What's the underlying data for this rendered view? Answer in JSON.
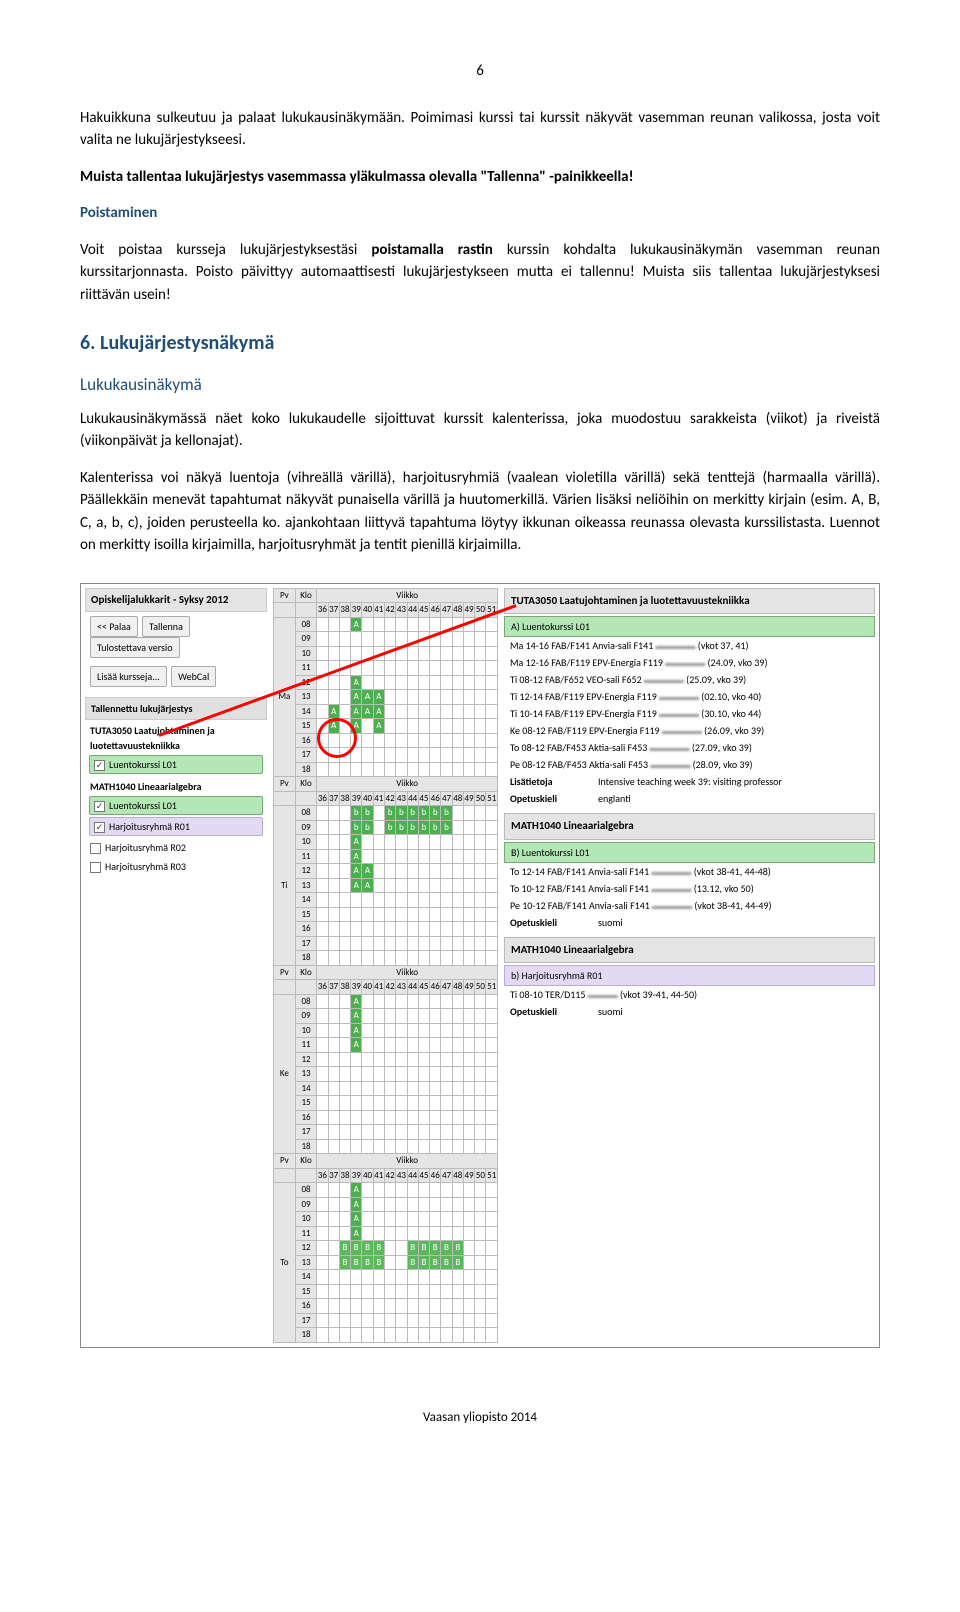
{
  "page_number": "6",
  "paragraphs": {
    "p1": "Hakuikkuna sulkeutuu ja palaat lukukausinäkymään. Poimimasi kurssi tai kurssit näkyvät vasemman reunan valikossa, josta voit valita ne lukujärjestykseesi.",
    "p2": "Muista tallentaa lukujärjestys vasemmassa yläkulmassa olevalla \"Tallenna\" -painikkeella!",
    "h_poistaminen": "Poistaminen",
    "p3a": "Voit poistaa kursseja lukujärjestyksestäsi ",
    "p3b": "poistamalla rastin",
    "p3c": " kurssin kohdalta lukukausinäkymän vasemman reunan kurssitarjonnasta. Poisto päivittyy automaattisesti lukujärjestykseen mutta ei tallennu! Muista siis tallentaa lukujärjestyksesi riittävän usein!",
    "h_section6": "6. Lukujärjestysnäkymä",
    "h_lukukausi": "Lukukausinäkymä",
    "p4": "Lukukausinäkymässä näet koko lukukaudelle sijoittuvat kurssit kalenterissa, joka muodostuu sarakkeista (viikot) ja riveistä (viikonpäivät ja kellonajat).",
    "p5": "Kalenterissa voi näkyä luentoja (vihreällä värillä), harjoitusryhmiä (vaalean violetilla värillä) sekä tenttejä (harmaalla värillä). Päällekkäin menevät tapahtumat näkyvät punaisella värillä ja huutomerkillä. Värien lisäksi neliöihin on merkitty kirjain (esim. A, B, C, a, b, c), joiden perusteella ko. ajankohtaan liittyvä tapahtuma löytyy ikkunan oikeassa reunassa olevasta kurssilistasta. Luennot on merkitty isoilla kirjaimilla, harjoitusryhmät ja tentit pienillä kirjaimilla."
  },
  "screenshot": {
    "panel_title": "Opiskelijalukkarit - Syksy 2012",
    "buttons": {
      "back": "<< Palaa",
      "save": "Tallenna",
      "print": "Tulostettava versio",
      "add": "Lisää kursseja...",
      "webcal": "WebCal"
    },
    "saved_title": "Tallennettu lukujärjestys",
    "course1": {
      "title": "TUTA3050 Laatujohtaminen ja luotettavuustekniikka",
      "item": "Luentokurssi L01"
    },
    "course2": {
      "title": "MATH1040 Lineaarialgebra",
      "items": [
        "Luentokurssi L01",
        "Harjoitusryhmä R01",
        "Harjoitusryhmä R02",
        "Harjoitusryhmä R03"
      ]
    },
    "cal": {
      "viikko": "Viikko",
      "pv": "Pv",
      "klo": "Klo",
      "weeks": [
        "36",
        "37",
        "38",
        "39",
        "40",
        "41",
        "42",
        "43",
        "44",
        "45",
        "46",
        "47",
        "48",
        "49",
        "50",
        "51"
      ],
      "days": [
        "Ma",
        "Ti",
        "Ke",
        "To"
      ],
      "hours": [
        "08",
        "09",
        "10",
        "11",
        "12",
        "13",
        "14",
        "15",
        "16",
        "17",
        "18"
      ]
    },
    "right": {
      "course1_title": "TUTA3050 Laatujohtaminen ja luotettavuustekniikka",
      "course1_sec": "A)  Luentokurssi L01",
      "course1_lines": [
        "Ma 14-16 FAB/F141 Anvia-sali F141",
        "Ma 12-16 FAB/F119 EPV-Energia F119",
        "Ti   08-12 FAB/F652 VEO-sali F652",
        "Ti   12-14 FAB/F119 EPV-Energia F119",
        "Ti   10-14 FAB/F119 EPV-Energia F119",
        "Ke 08-12 FAB/F119 EPV-Energia F119",
        "To 08-12 FAB/F453 Aktia-sali F453",
        "Pe 08-12 FAB/F453 Aktia-sali F453"
      ],
      "course1_dates": [
        "(vkot 37, 41)",
        "(24.09, vko 39)",
        "(25.09, vko 39)",
        "(02.10, vko 40)",
        "(30.10, vko 44)",
        "(26.09, vko 39)",
        "(27.09, vko 39)",
        "(28.09, vko 39)"
      ],
      "lisatietoja": "Lisätietoja",
      "lisatietoja_val": "Intensive teaching week 39: visiting professor",
      "opetuskieli": "Opetuskieli",
      "englanti": "englanti",
      "suomi": "suomi",
      "course2_title": "MATH1040 Lineaarialgebra",
      "course2_secB": "B)  Luentokurssi L01",
      "course2_lines": [
        "To 12-14 FAB/F141 Anvia-sali F141",
        "To 10-12 FAB/F141 Anvia-sali F141",
        "Pe 10-12 FAB/F141 Anvia-sali F141"
      ],
      "course2_dates": [
        "(vkot 38-41, 44-48)",
        "(13.12, vko 50)",
        "(vkot 38-41, 44-49)"
      ],
      "course2_secb": "b)  Harjoitusryhmä R01",
      "course2_b_line": "Ti 08-10 TER/D115",
      "course2_b_date": "(vkot 39-41, 44-50)"
    }
  },
  "footer": "Vaasan yliopisto 2014"
}
